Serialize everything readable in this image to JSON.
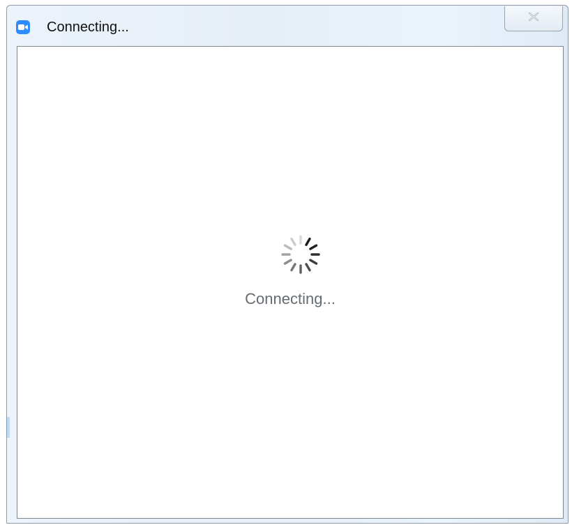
{
  "window": {
    "title": "Connecting...",
    "app_icon": "zoom-video-icon",
    "close_icon": "close-icon"
  },
  "main": {
    "status_text": "Connecting...",
    "spinner_icon": "loading-spinner-icon"
  },
  "colors": {
    "accent": "#2d8cff",
    "status_text": "#666c73",
    "title_text": "#111111"
  }
}
